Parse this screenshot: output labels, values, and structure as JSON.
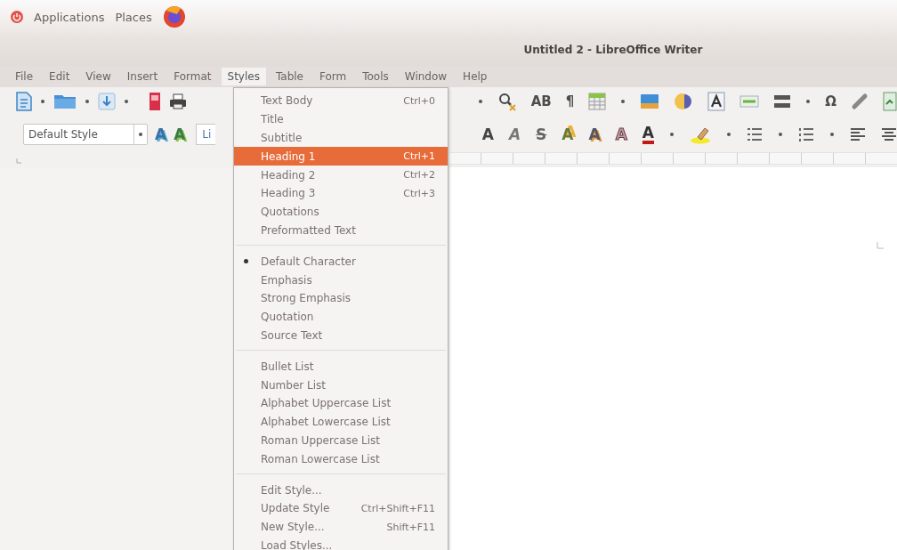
{
  "top_panel": {
    "items": [
      "Applications",
      "Places"
    ]
  },
  "window": {
    "title": "Untitled 2 - LibreOffice Writer"
  },
  "menubar": [
    {
      "label": "File",
      "selected": false
    },
    {
      "label": "Edit",
      "selected": false
    },
    {
      "label": "View",
      "selected": false
    },
    {
      "label": "Insert",
      "selected": false
    },
    {
      "label": "Format",
      "selected": false
    },
    {
      "label": "Styles",
      "selected": true
    },
    {
      "label": "Table",
      "selected": false
    },
    {
      "label": "Form",
      "selected": false
    },
    {
      "label": "Tools",
      "selected": false
    },
    {
      "label": "Window",
      "selected": false
    },
    {
      "label": "Help",
      "selected": false
    }
  ],
  "toolbar_1": {
    "glyphs": [
      "AB",
      "¶",
      "Ω"
    ]
  },
  "toolbar_2": {
    "paragraph_style": "Default Style",
    "style_buttons": [
      "A",
      "A"
    ],
    "font_name": "Li",
    "format_buttons": [
      {
        "text": "A",
        "kind": "bold"
      },
      {
        "text": "A",
        "kind": "italic"
      },
      {
        "text": "S",
        "kind": "strike"
      },
      {
        "text": "A",
        "kind": "super"
      },
      {
        "text": "A",
        "kind": "shadow"
      },
      {
        "text": "A",
        "kind": "outline"
      },
      {
        "text": "A",
        "kind": "color"
      }
    ]
  },
  "styles_menu": [
    [
      {
        "label": "Text Body",
        "shortcut": "Ctrl+0",
        "selected": false,
        "checked": false
      },
      {
        "label": "Title",
        "selected": false,
        "checked": false
      },
      {
        "label": "Subtitle",
        "selected": false,
        "checked": false
      },
      {
        "label": "Heading 1",
        "shortcut": "Ctrl+1",
        "selected": true,
        "checked": false
      },
      {
        "label": "Heading 2",
        "shortcut": "Ctrl+2",
        "selected": false,
        "checked": false
      },
      {
        "label": "Heading 3",
        "shortcut": "Ctrl+3",
        "selected": false,
        "checked": false
      },
      {
        "label": "Quotations",
        "selected": false,
        "checked": false
      },
      {
        "label": "Preformatted Text",
        "selected": false,
        "checked": false
      }
    ],
    [
      {
        "label": "Default Character",
        "selected": false,
        "checked": true
      },
      {
        "label": "Emphasis",
        "selected": false,
        "checked": false
      },
      {
        "label": "Strong Emphasis",
        "selected": false,
        "checked": false
      },
      {
        "label": "Quotation",
        "selected": false,
        "checked": false
      },
      {
        "label": "Source Text",
        "selected": false,
        "checked": false
      }
    ],
    [
      {
        "label": "Bullet List",
        "selected": false,
        "checked": false
      },
      {
        "label": "Number List",
        "selected": false,
        "checked": false
      },
      {
        "label": "Alphabet Uppercase List",
        "selected": false,
        "checked": false
      },
      {
        "label": "Alphabet Lowercase List",
        "selected": false,
        "checked": false
      },
      {
        "label": "Roman Uppercase List",
        "selected": false,
        "checked": false
      },
      {
        "label": "Roman Lowercase List",
        "selected": false,
        "checked": false
      }
    ],
    [
      {
        "label": "Edit Style...",
        "selected": false,
        "checked": false
      },
      {
        "label": "Update Style",
        "shortcut": "Ctrl+Shift+F11",
        "selected": false,
        "checked": false
      },
      {
        "label": "New Style...",
        "shortcut": "Shift+F11",
        "selected": false,
        "checked": false
      },
      {
        "label": "Load Styles...",
        "selected": false,
        "checked": false
      }
    ]
  ]
}
